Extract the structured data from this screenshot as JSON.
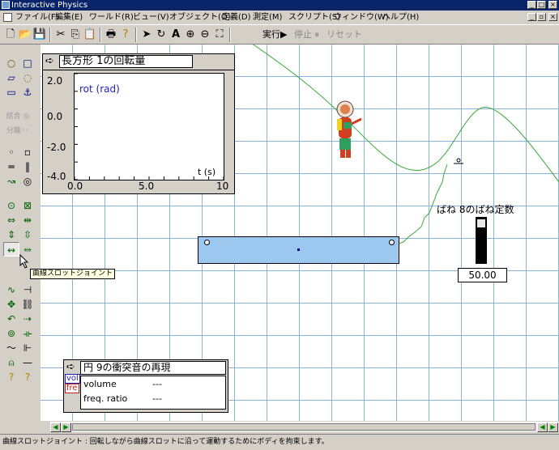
{
  "window": {
    "title": "Interactive Physics",
    "minimize": "_",
    "restore": "□",
    "close": "×",
    "doc_minimize": "_",
    "doc_restore": "▫",
    "doc_close": "×"
  },
  "menu": [
    "ファイル(F)",
    "編集(E)",
    "ワールド(R)",
    "ビュー(V)",
    "オブジェクト(O)",
    "定義(D)",
    "測定(M)",
    "スクリプト(S)",
    "ウィンドウ(W)",
    "ヘルプ(H)"
  ],
  "toolbar": {
    "run_label": "実行▶",
    "stop_label": "停止 ⏸",
    "reset_label": "リセット"
  },
  "graph": {
    "title": "長方形 1の回転量",
    "arrow": "➪"
  },
  "sound_window": {
    "arrow": "➪",
    "title": "円 9の衝突音の再現",
    "tag_vol": "vol",
    "tag_fre": "fre",
    "rows": [
      {
        "label": "volume",
        "value": "---"
      },
      {
        "label": "freq. ratio",
        "value": "---"
      }
    ]
  },
  "spring": {
    "label": "ばね 8のばね定数",
    "value": "50.00",
    "slider_level": 0.05
  },
  "tooltip": "曲線スロットジョイント",
  "statusbar": "曲線スロットジョイント : 回転しながら曲線スロットに沿って運動するためにボディを拘束します。",
  "chart_data": {
    "type": "line",
    "title": "長方形 1の回転量",
    "ylabel": "rot (rad)",
    "xlabel": "t (s)",
    "xlim": [
      0,
      10
    ],
    "ylim": [
      -4,
      2
    ],
    "xticks": [
      "0.0",
      "5.0",
      "10"
    ],
    "yticks": [
      "2.0",
      "0.0",
      "-2.0",
      "-4.0"
    ],
    "series": []
  }
}
